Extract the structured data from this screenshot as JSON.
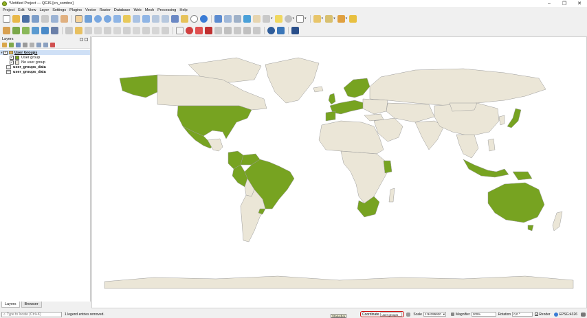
{
  "window": {
    "title": "*Untitled Project — QGIS [en_sombre]",
    "buttons": [
      "–",
      "❐",
      "✕"
    ]
  },
  "menu": [
    "Project",
    "Edit",
    "View",
    "Layer",
    "Settings",
    "Plugins",
    "Vector",
    "Raster",
    "Database",
    "Web",
    "Mesh",
    "Processing",
    "Help"
  ],
  "layers_panel": {
    "title": "Layers",
    "group": {
      "label": "User Groups",
      "expanded": true,
      "checked": true
    },
    "legend": [
      {
        "label": "User group",
        "color": "#77a321",
        "checked": true
      },
      {
        "label": "No user group",
        "color": "#ebe6d7",
        "checked": true
      }
    ],
    "tables": [
      "user_groups_data",
      "user_groups_data"
    ],
    "tabs": [
      "Layers",
      "Browser"
    ]
  },
  "map": {
    "ocean": "#ffffff",
    "land_default": "#ebe6d7",
    "land_group": "#77a321",
    "border": "#9a9a9a"
  },
  "status": {
    "locator_placeholder": "Type to locate (Ctrl+K)",
    "message": "1 legend entries removed.",
    "tooltip": "Statusbar",
    "coordinate_label": "Coordinate",
    "coordinate_value": "user groups",
    "scale_label": "Scale",
    "scale_value": "1:94395920",
    "magnifier_label": "Magnifier",
    "magnifier_value": "100%",
    "rotation_label": "Rotation",
    "rotation_value": "0,0 °",
    "render_label": "Render",
    "render_checked": true,
    "crs": "EPSG:4326"
  },
  "colors": {
    "accent_red": "#d01010",
    "qgis_green": "#93b023"
  }
}
